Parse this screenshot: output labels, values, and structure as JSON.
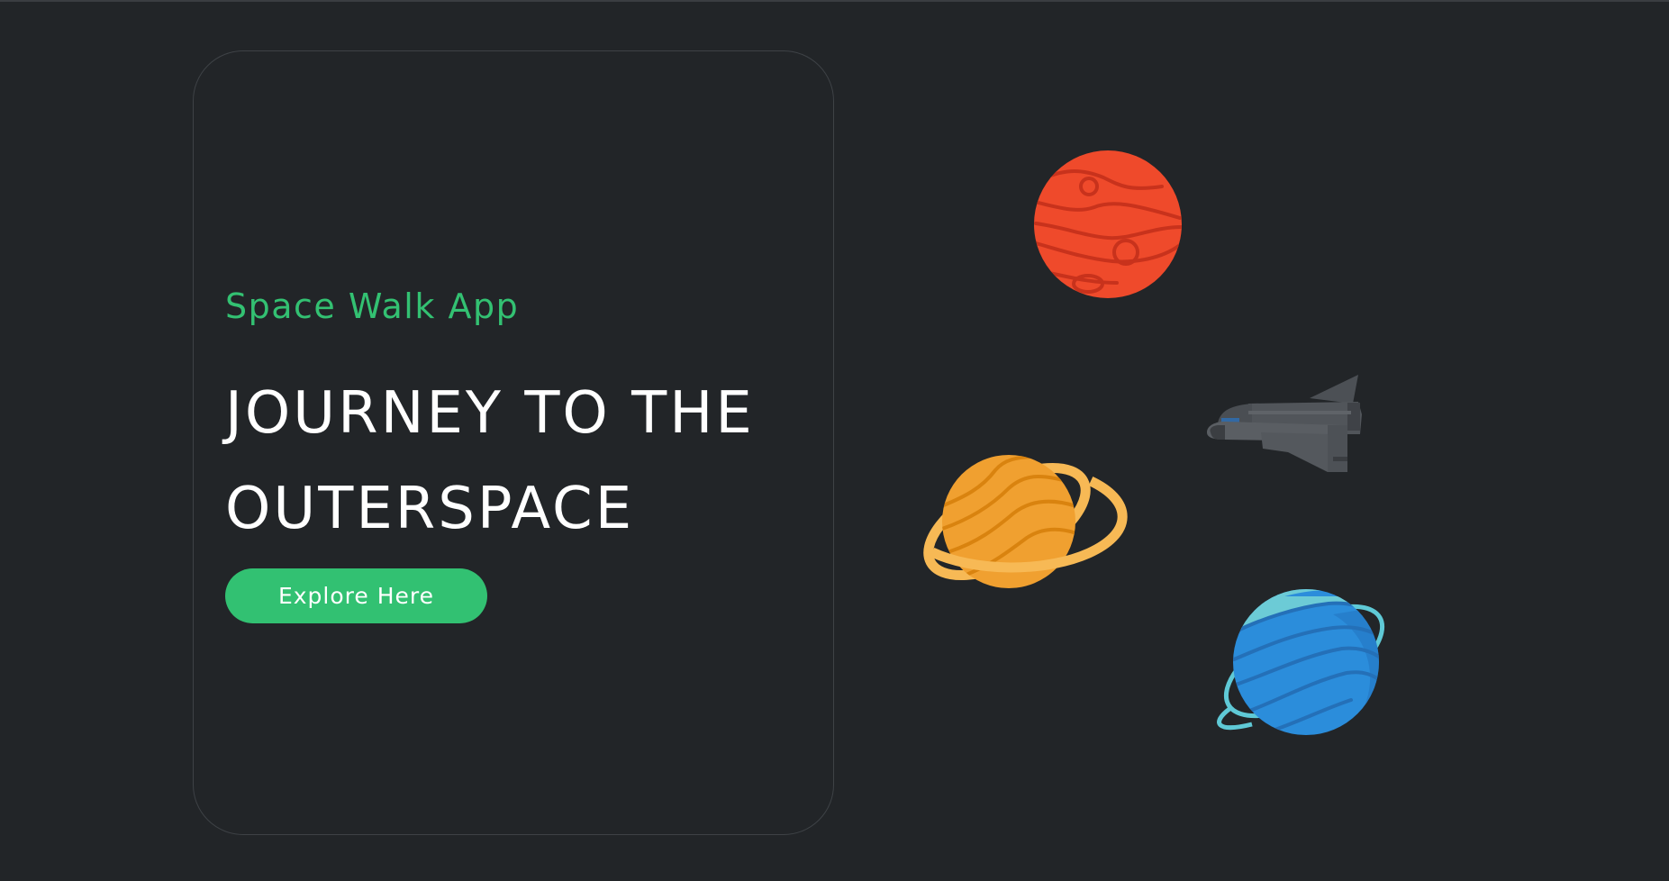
{
  "hero": {
    "app_name": "Space Walk App",
    "headline_line1": "JOURNEY TO THE",
    "headline_line2": "OUTERSPACE",
    "cta_label": "Explore Here"
  },
  "illustration": {
    "items": [
      "red-planet-icon",
      "ringed-orange-planet-icon",
      "space-shuttle-icon",
      "ringed-blue-planet-icon"
    ]
  },
  "colors": {
    "background": "#222528",
    "accent": "#32c172",
    "headline": "#ffffff",
    "card_border": "#3e4246"
  }
}
